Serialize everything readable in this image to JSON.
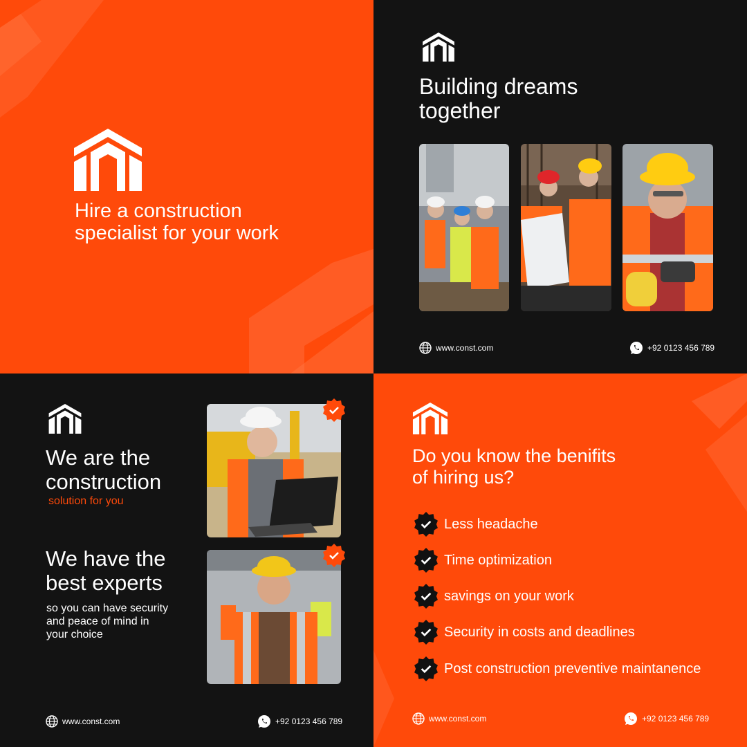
{
  "colors": {
    "accent": "#FF4A0A",
    "dark": "#131313",
    "white": "#FFFFFF"
  },
  "q1": {
    "title_line1": "Hire a construction",
    "title_line2": "specialist for your work"
  },
  "q2": {
    "title_line1": "Building dreams",
    "title_line2": "together",
    "website": "www.const.com",
    "phone": "+92 0123 456 789"
  },
  "q3": {
    "heading1_line1": "We are the",
    "heading1_line2": "construction",
    "sub1": "solution for you",
    "heading2_line1": "We have the",
    "heading2_line2": "best experts",
    "body_line1": "so you can have security",
    "body_line2": "and peace of mind in",
    "body_line3": "your choice",
    "website": "www.const.com",
    "phone": "+92 0123 456 789"
  },
  "q4": {
    "title_line1": "Do you know the benifits",
    "title_line2": "of hiring us?",
    "benefits": [
      "Less headache",
      "Time optimization",
      "savings on your work",
      "Security in costs and deadlines",
      "Post construction preventive maintanence"
    ],
    "website": "www.const.com",
    "phone": "+92 0123 456 789"
  },
  "icons": {
    "logo": "house-logo-icon",
    "globe": "globe-icon",
    "phone": "whatsapp-icon",
    "check": "check-badge-icon"
  }
}
